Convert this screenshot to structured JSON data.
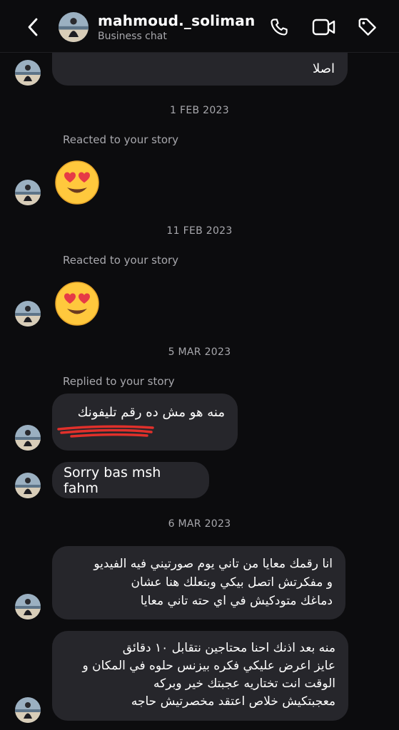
{
  "header": {
    "username": "mahmoud._soliman",
    "subtitle": "Business chat",
    "icons": [
      "back-icon",
      "phone-icon",
      "video-icon",
      "tag-icon"
    ]
  },
  "messages": {
    "m0": "اصلا",
    "date1": "1 FEB 2023",
    "story1": "Reacted to your story",
    "date2": "11 FEB 2023",
    "story2": "Reacted to your story",
    "date3": "5 MAR 2023",
    "story3": "Replied to your story",
    "m1": "منه هو مش ده رقم تليفونك",
    "m2": "Sorry bas msh fahm",
    "date4": "6 MAR 2023",
    "m3_l1": "انا رقمك معايا من تاني يوم صورتيني فيه الفيديو",
    "m3_l2": "و مفكرتش اتصل بيكي وبتعلك هنا عشان",
    "m3_l3": "دماغك متودكيش في اي حته تاني معايا",
    "m4_l1": "منه بعد اذنك احنا محتاجين نتقابل ١٠ دقائق",
    "m4_l2": "عايز اعرض عليكي فكره بيزنس حلوه في المكان و",
    "m4_l3": "الوقت انت تختاريه  عجبتك خير وبركه",
    "m4_l4": "معجبتكيش خلاص اعتقد مخصرتيش حاجه"
  },
  "colors": {
    "background": "#0c0c0e",
    "bubble": "#26262b",
    "meta_text": "#a8a8ad",
    "redaction": "#e0302b"
  }
}
